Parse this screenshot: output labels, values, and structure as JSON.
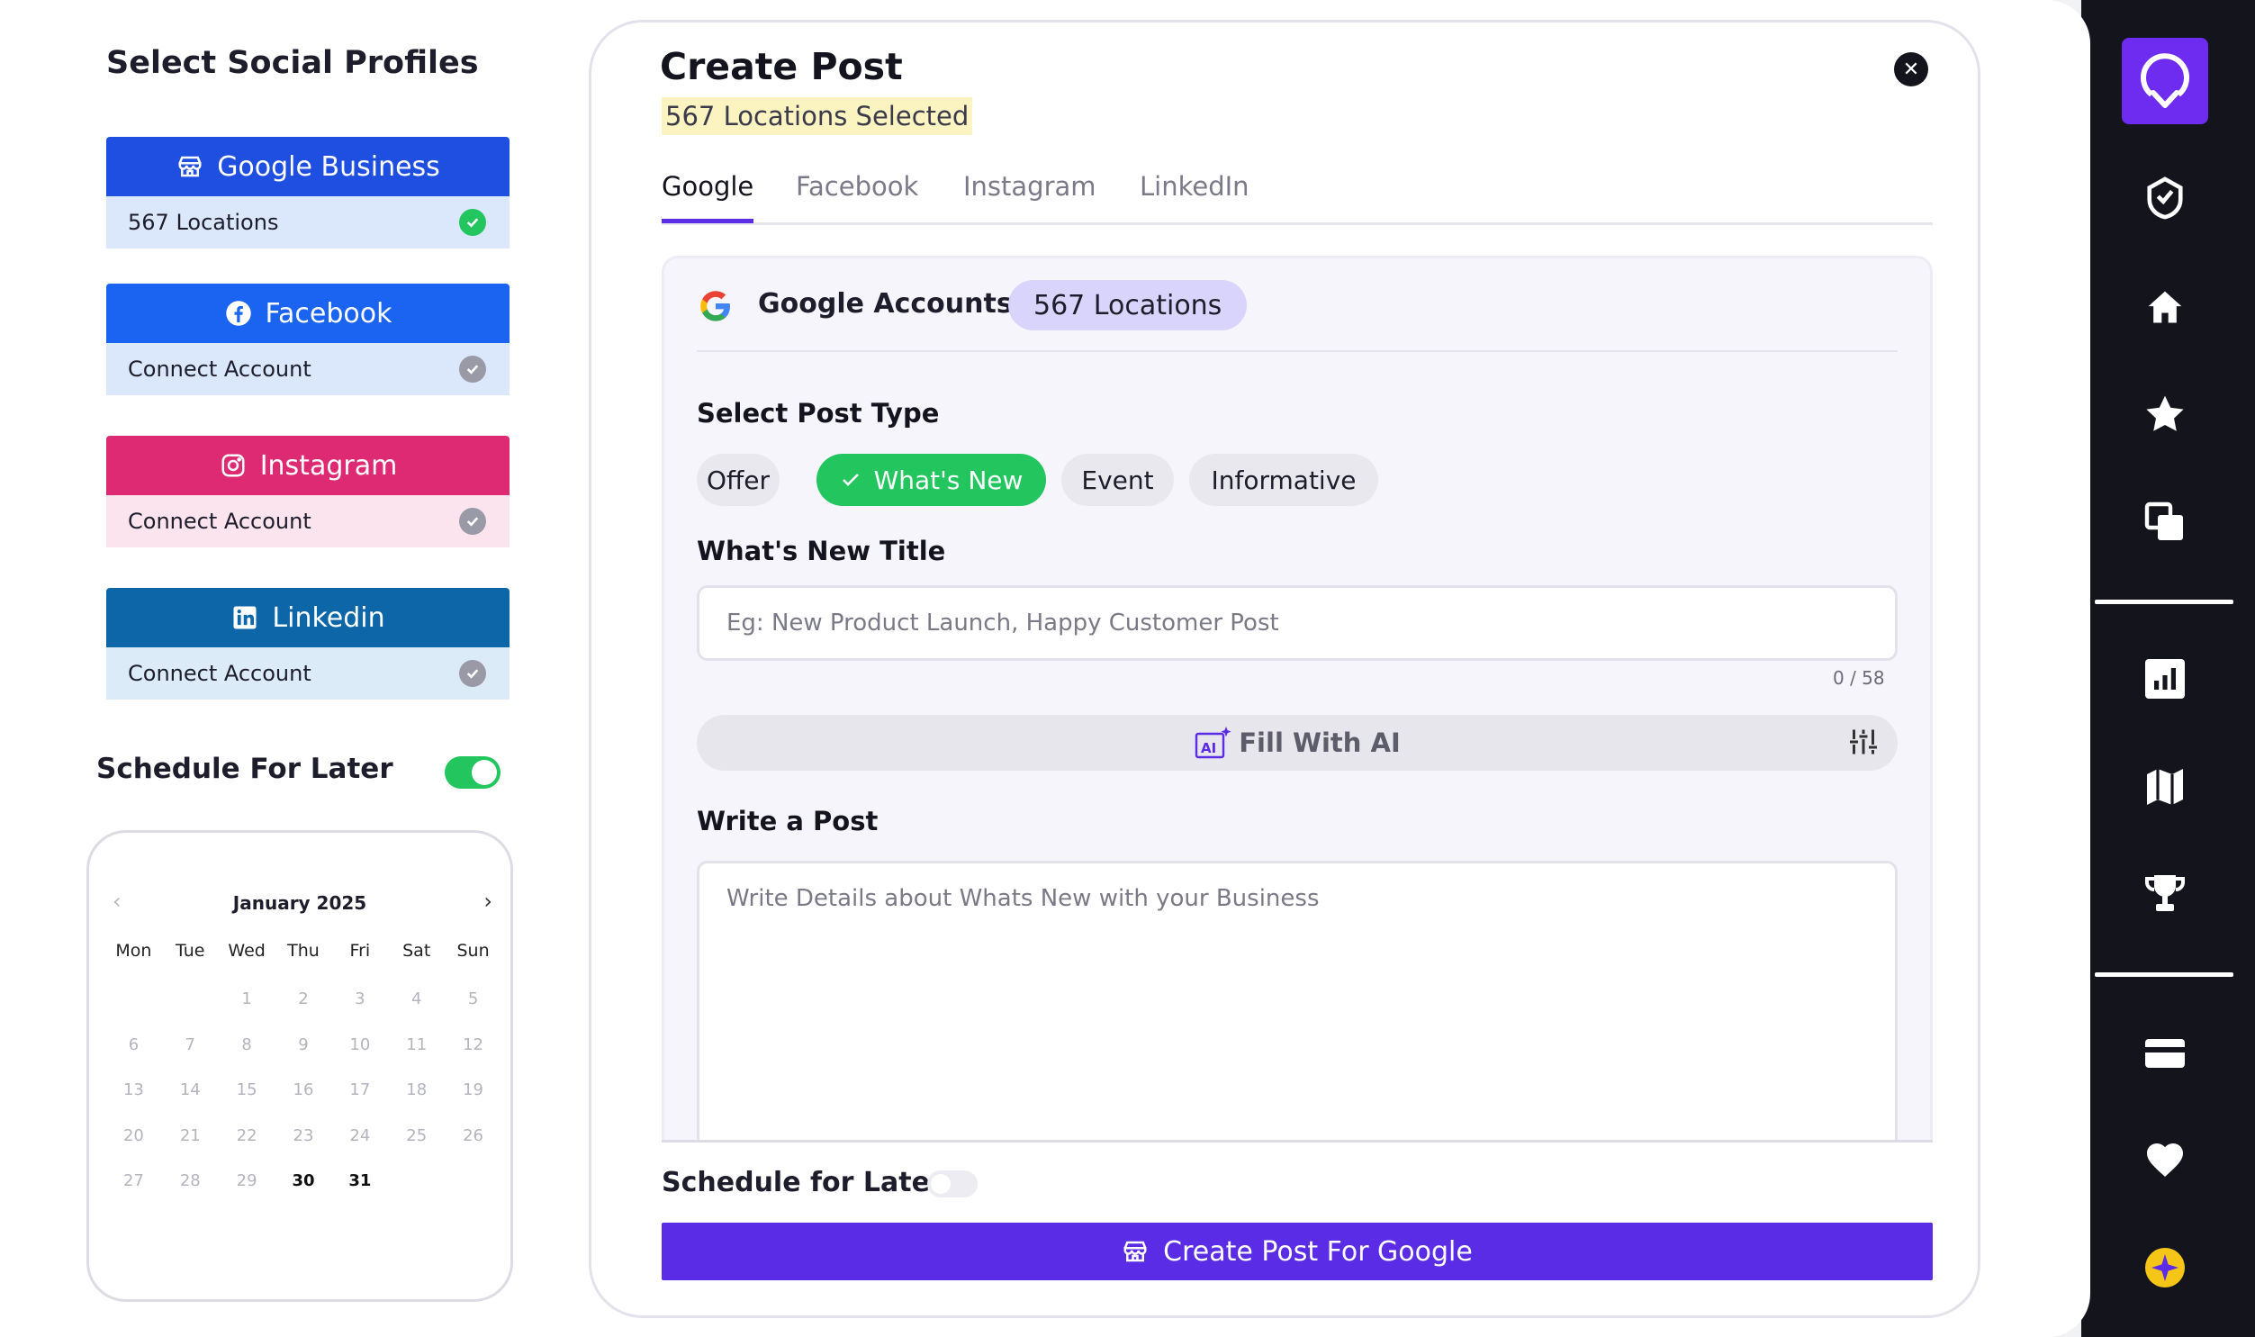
{
  "left": {
    "title": "Select Social Profiles",
    "profiles": [
      {
        "name": "Google Business",
        "status": "567 Locations",
        "connected": true,
        "icon": "storefront-icon",
        "head_color": "#1f4fe0",
        "body_color": "#dbe8fc"
      },
      {
        "name": "Facebook",
        "status": "Connect Account",
        "connected": false,
        "icon": "facebook-icon",
        "head_color": "#1b64f2",
        "body_color": "#dbe8fc"
      },
      {
        "name": "Instagram",
        "status": "Connect Account",
        "connected": false,
        "icon": "instagram-icon",
        "head_color": "#de2a73",
        "body_color": "#fbe4ee"
      },
      {
        "name": "Linkedin",
        "status": "Connect Account",
        "connected": false,
        "icon": "linkedin-icon",
        "head_color": "#0d66a8",
        "body_color": "#dcebf8"
      }
    ],
    "schedule_label": "Schedule For Later",
    "schedule_on": true,
    "calendar": {
      "month": "January 2025",
      "weekdays": [
        "Mon",
        "Tue",
        "Wed",
        "Thu",
        "Fri",
        "Sat",
        "Sun"
      ],
      "days": [
        "",
        "",
        "1",
        "2",
        "3",
        "4",
        "5",
        "6",
        "7",
        "8",
        "9",
        "10",
        "11",
        "12",
        "13",
        "14",
        "15",
        "16",
        "17",
        "18",
        "19",
        "20",
        "21",
        "22",
        "23",
        "24",
        "25",
        "26",
        "27",
        "28",
        "29",
        "30",
        "31"
      ],
      "enabled_days": [
        "30",
        "31"
      ]
    }
  },
  "card": {
    "title": "Create Post",
    "subtitle": "567 Locations Selected",
    "tabs": [
      "Google",
      "Facebook",
      "Instagram",
      "LinkedIn"
    ],
    "active_tab": "Google",
    "accounts_label": "Google Accounts:",
    "accounts_pill": "567 Locations",
    "post_type_label": "Select Post Type",
    "post_types": [
      "Offer",
      "What's New",
      "Event",
      "Informative"
    ],
    "selected_post_type": "What's New",
    "title_label": "What's New Title",
    "title_placeholder": "Eg: New Product Launch, Happy Customer Post",
    "title_counter": "0 / 58",
    "fill_ai_label": "Fill With AI",
    "write_label": "Write a Post",
    "write_placeholder": "Write Details about Whats New with your Business",
    "schedule_label": "Schedule for Later",
    "schedule_on": false,
    "create_button": "Create Post For Google"
  },
  "sidebar": {
    "icons": [
      "location-pin-logo-icon",
      "badge-check-icon",
      "home-icon",
      "star-icon",
      "copy-icon",
      "bar-chart-icon",
      "map-icon",
      "trophy-icon",
      "credit-card-icon",
      "heart-icon",
      "sparkle-icon"
    ]
  },
  "colors": {
    "accent": "#5b2ce6",
    "success": "#22c55e",
    "sidebar_bg": "#14141c",
    "highlight": "#fbf3c0"
  }
}
